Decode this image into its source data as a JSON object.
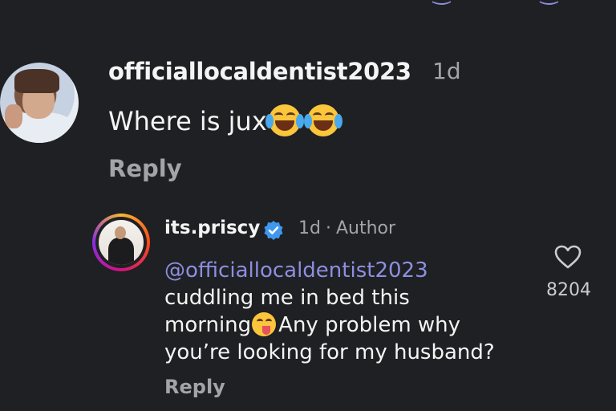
{
  "comment": {
    "username": "officiallocaldentist2023",
    "time": "1d",
    "text": "Where is jux",
    "emojis": [
      "face-with-tears-of-joy",
      "face-with-tears-of-joy"
    ],
    "reply_label": "Reply"
  },
  "reply": {
    "username": "its.priscy",
    "verified": true,
    "time": "1d",
    "separator": "·",
    "role": "Author",
    "mention": "@officiallocaldentist2023",
    "line1": "cuddling me in bed this",
    "line2_a": "morning",
    "line2_emoji": "face-savoring-food",
    "line2_b": "Any problem why",
    "line3": "you’re looking for my husband?",
    "reply_label": "Reply",
    "like_count": "8204"
  },
  "colors": {
    "background": "#1f2023",
    "mention": "#8d8fe0",
    "muted": "#a2a4a8",
    "verified": "#3f97f0"
  }
}
